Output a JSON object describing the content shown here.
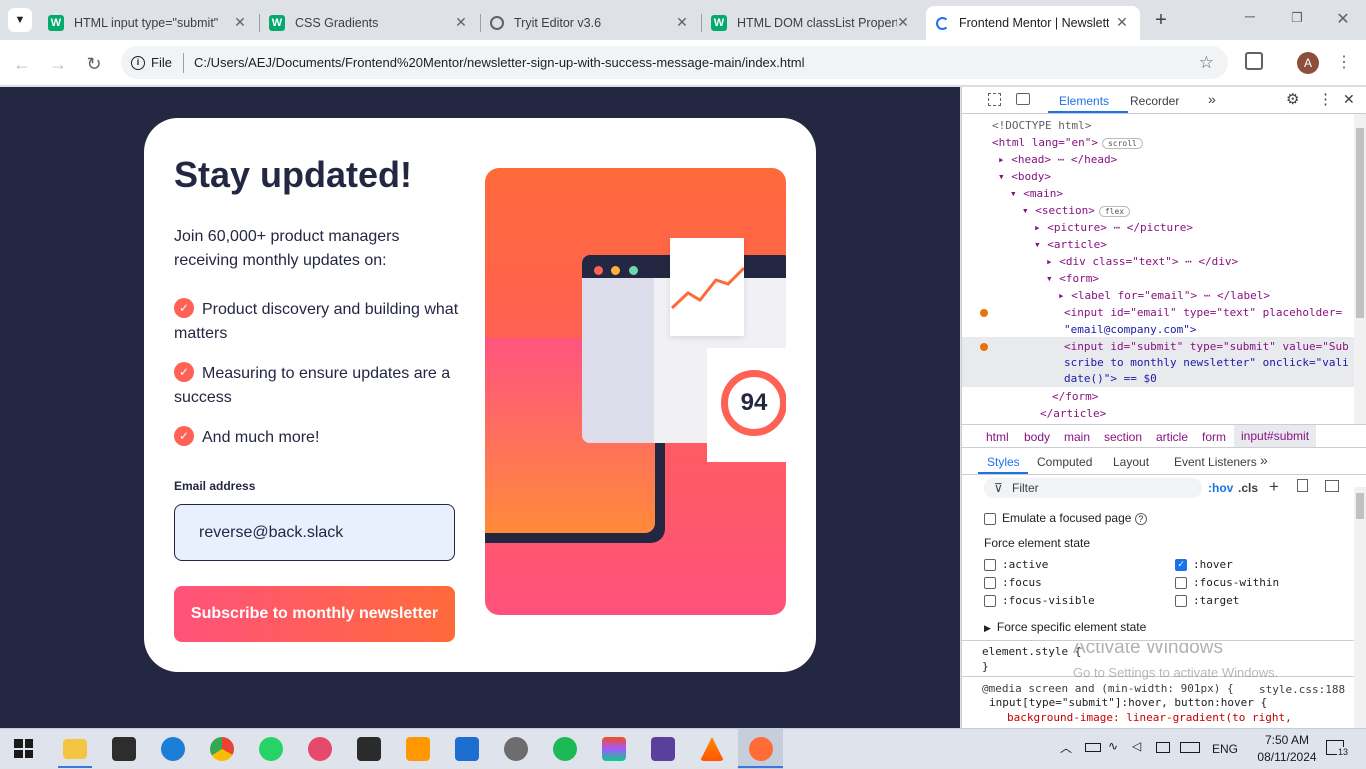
{
  "browser": {
    "tabs": [
      {
        "title": "HTML input type=\"submit\"",
        "icon": "w3schools-icon"
      },
      {
        "title": "CSS Gradients",
        "icon": "w3schools-icon"
      },
      {
        "title": "Tryit Editor v3.6",
        "icon": "globe-icon"
      },
      {
        "title": "HTML DOM classList Propert",
        "icon": "w3schools-icon"
      },
      {
        "title": "Frontend Mentor | Newslette",
        "icon": "loading-icon"
      }
    ],
    "scheme_label": "File",
    "url": "C:/Users/AEJ/Documents/Frontend%20Mentor/newsletter-sign-up-with-success-message-main/index.html",
    "profile_initial": "A"
  },
  "page": {
    "heading": "Stay updated!",
    "intro": "Join 60,000+ product managers receiving monthly updates on:",
    "features": [
      "Product discovery and building what matters",
      "Measuring to ensure updates are a success",
      "And much more!"
    ],
    "email_label": "Email address",
    "email_value": "reverse@back.slack",
    "email_placeholder": "email@company.com",
    "submit_label": "Subscribe to monthly newsletter",
    "score": "94",
    "colors": {
      "accent": "#ff6155",
      "navy": "#242742"
    }
  },
  "devtools": {
    "tabs": [
      "Elements",
      "Recorder"
    ],
    "dom_lines": [
      "<!DOCTYPE html>",
      "<html lang=\"en\">",
      "<head>",
      "<body>",
      "<main>",
      "<section>",
      "<picture>",
      "<article>",
      "<div class=\"text\">",
      "<form>",
      "<label for=\"email\">",
      "<input id=\"email\" type=\"text\" placeholder=",
      "\"email@company.com\">",
      "<input id=\"submit\" type=\"submit\" value=\"Sub",
      "scribe to monthly newsletter\" onclick=\"vali",
      "date()\"> == $0",
      "</form>",
      "</article>"
    ],
    "badges": {
      "scroll": "scroll",
      "flex": "flex"
    },
    "breadcrumb": [
      "html",
      "body",
      "main",
      "section",
      "article",
      "form",
      "input#submit"
    ],
    "style_tabs": [
      "Styles",
      "Computed",
      "Layout",
      "Event Listeners"
    ],
    "filter_placeholder": "Filter",
    "hov": ":hov",
    "cls": ".cls",
    "emulate_focus": "Emulate a focused page",
    "force_state_title": "Force element state",
    "states_left": [
      ":active",
      ":focus",
      ":focus-visible"
    ],
    "states_right": [
      ":hover",
      ":focus-within",
      ":target"
    ],
    "force_specific": "Force specific element state",
    "rule_element_style": "element.style {",
    "rule_close": "}",
    "media_rule": "@media screen and (min-width: 901px) {",
    "selector_rule": "input[type=\"submit\"]:hover, button:hover {",
    "property_rule": "background-image: linear-gradient(to right,",
    "source_file": "style.css:188",
    "watermark_title": "Activate Windows",
    "watermark_sub": "Go to Settings to activate Windows."
  },
  "taskbar": {
    "time": "7:50 AM",
    "date": "08/11/2024",
    "lang": "ENG",
    "notifications": "13"
  }
}
